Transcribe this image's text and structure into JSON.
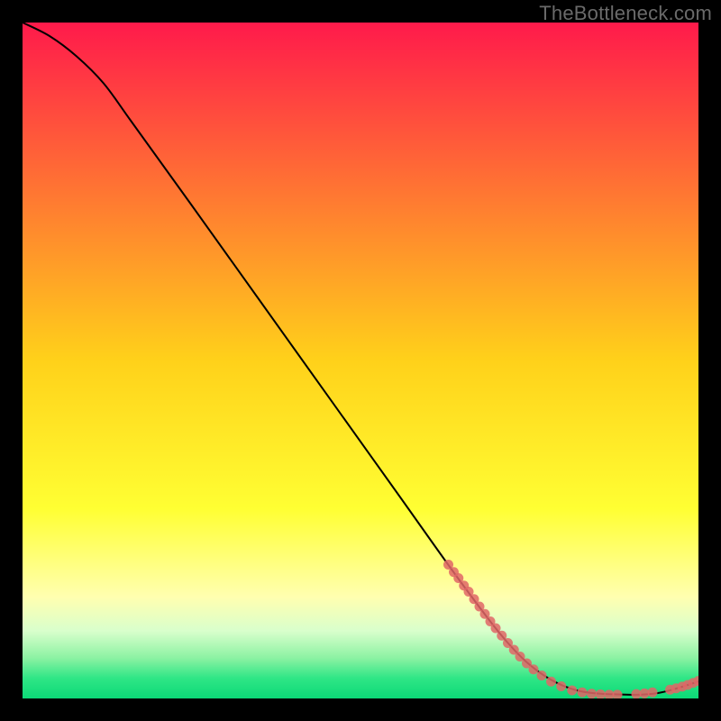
{
  "watermark": "TheBottleneck.com",
  "chart_data": {
    "type": "line",
    "title": "",
    "xlabel": "",
    "ylabel": "",
    "xlim": [
      0,
      100
    ],
    "ylim": [
      0,
      100
    ],
    "grid": false,
    "background_gradient": {
      "stops": [
        {
          "pos": 0.0,
          "color": "#ff1a4b"
        },
        {
          "pos": 0.5,
          "color": "#ffd11a"
        },
        {
          "pos": 0.72,
          "color": "#ffff33"
        },
        {
          "pos": 0.85,
          "color": "#ffffb0"
        },
        {
          "pos": 0.9,
          "color": "#d9ffcc"
        },
        {
          "pos": 0.94,
          "color": "#8cf2a3"
        },
        {
          "pos": 0.97,
          "color": "#2fe686"
        },
        {
          "pos": 1.0,
          "color": "#0cd977"
        }
      ]
    },
    "curve": [
      {
        "x": 0,
        "y": 100
      },
      {
        "x": 4,
        "y": 98
      },
      {
        "x": 8,
        "y": 95
      },
      {
        "x": 12,
        "y": 91
      },
      {
        "x": 16,
        "y": 85.5
      },
      {
        "x": 25,
        "y": 73
      },
      {
        "x": 40,
        "y": 52
      },
      {
        "x": 55,
        "y": 31
      },
      {
        "x": 65,
        "y": 17
      },
      {
        "x": 72,
        "y": 8
      },
      {
        "x": 77,
        "y": 3.5
      },
      {
        "x": 82,
        "y": 1.2
      },
      {
        "x": 88,
        "y": 0.6
      },
      {
        "x": 94,
        "y": 0.8
      },
      {
        "x": 100,
        "y": 2.5
      }
    ],
    "scatter_points": [
      {
        "x": 63.0,
        "y": 19.8
      },
      {
        "x": 63.8,
        "y": 18.7
      },
      {
        "x": 64.5,
        "y": 17.8
      },
      {
        "x": 65.3,
        "y": 16.7
      },
      {
        "x": 66.0,
        "y": 15.8
      },
      {
        "x": 66.8,
        "y": 14.7
      },
      {
        "x": 67.6,
        "y": 13.6
      },
      {
        "x": 68.4,
        "y": 12.5
      },
      {
        "x": 69.2,
        "y": 11.4
      },
      {
        "x": 70.0,
        "y": 10.4
      },
      {
        "x": 70.9,
        "y": 9.3
      },
      {
        "x": 71.8,
        "y": 8.2
      },
      {
        "x": 72.7,
        "y": 7.2
      },
      {
        "x": 73.6,
        "y": 6.2
      },
      {
        "x": 74.6,
        "y": 5.2
      },
      {
        "x": 75.6,
        "y": 4.3
      },
      {
        "x": 76.8,
        "y": 3.4
      },
      {
        "x": 78.2,
        "y": 2.5
      },
      {
        "x": 79.7,
        "y": 1.8
      },
      {
        "x": 81.3,
        "y": 1.2
      },
      {
        "x": 82.8,
        "y": 0.9
      },
      {
        "x": 84.2,
        "y": 0.7
      },
      {
        "x": 85.5,
        "y": 0.6
      },
      {
        "x": 86.8,
        "y": 0.55
      },
      {
        "x": 88.0,
        "y": 0.55
      },
      {
        "x": 90.8,
        "y": 0.65
      },
      {
        "x": 92.0,
        "y": 0.75
      },
      {
        "x": 93.2,
        "y": 0.9
      },
      {
        "x": 95.8,
        "y": 1.3
      },
      {
        "x": 96.7,
        "y": 1.5
      },
      {
        "x": 97.6,
        "y": 1.75
      },
      {
        "x": 98.4,
        "y": 2.0
      },
      {
        "x": 99.2,
        "y": 2.3
      },
      {
        "x": 100.0,
        "y": 2.6
      }
    ],
    "scatter_color": "#e06666",
    "scatter_radius": 5.5,
    "curve_color": "#000000",
    "curve_width": 2
  }
}
